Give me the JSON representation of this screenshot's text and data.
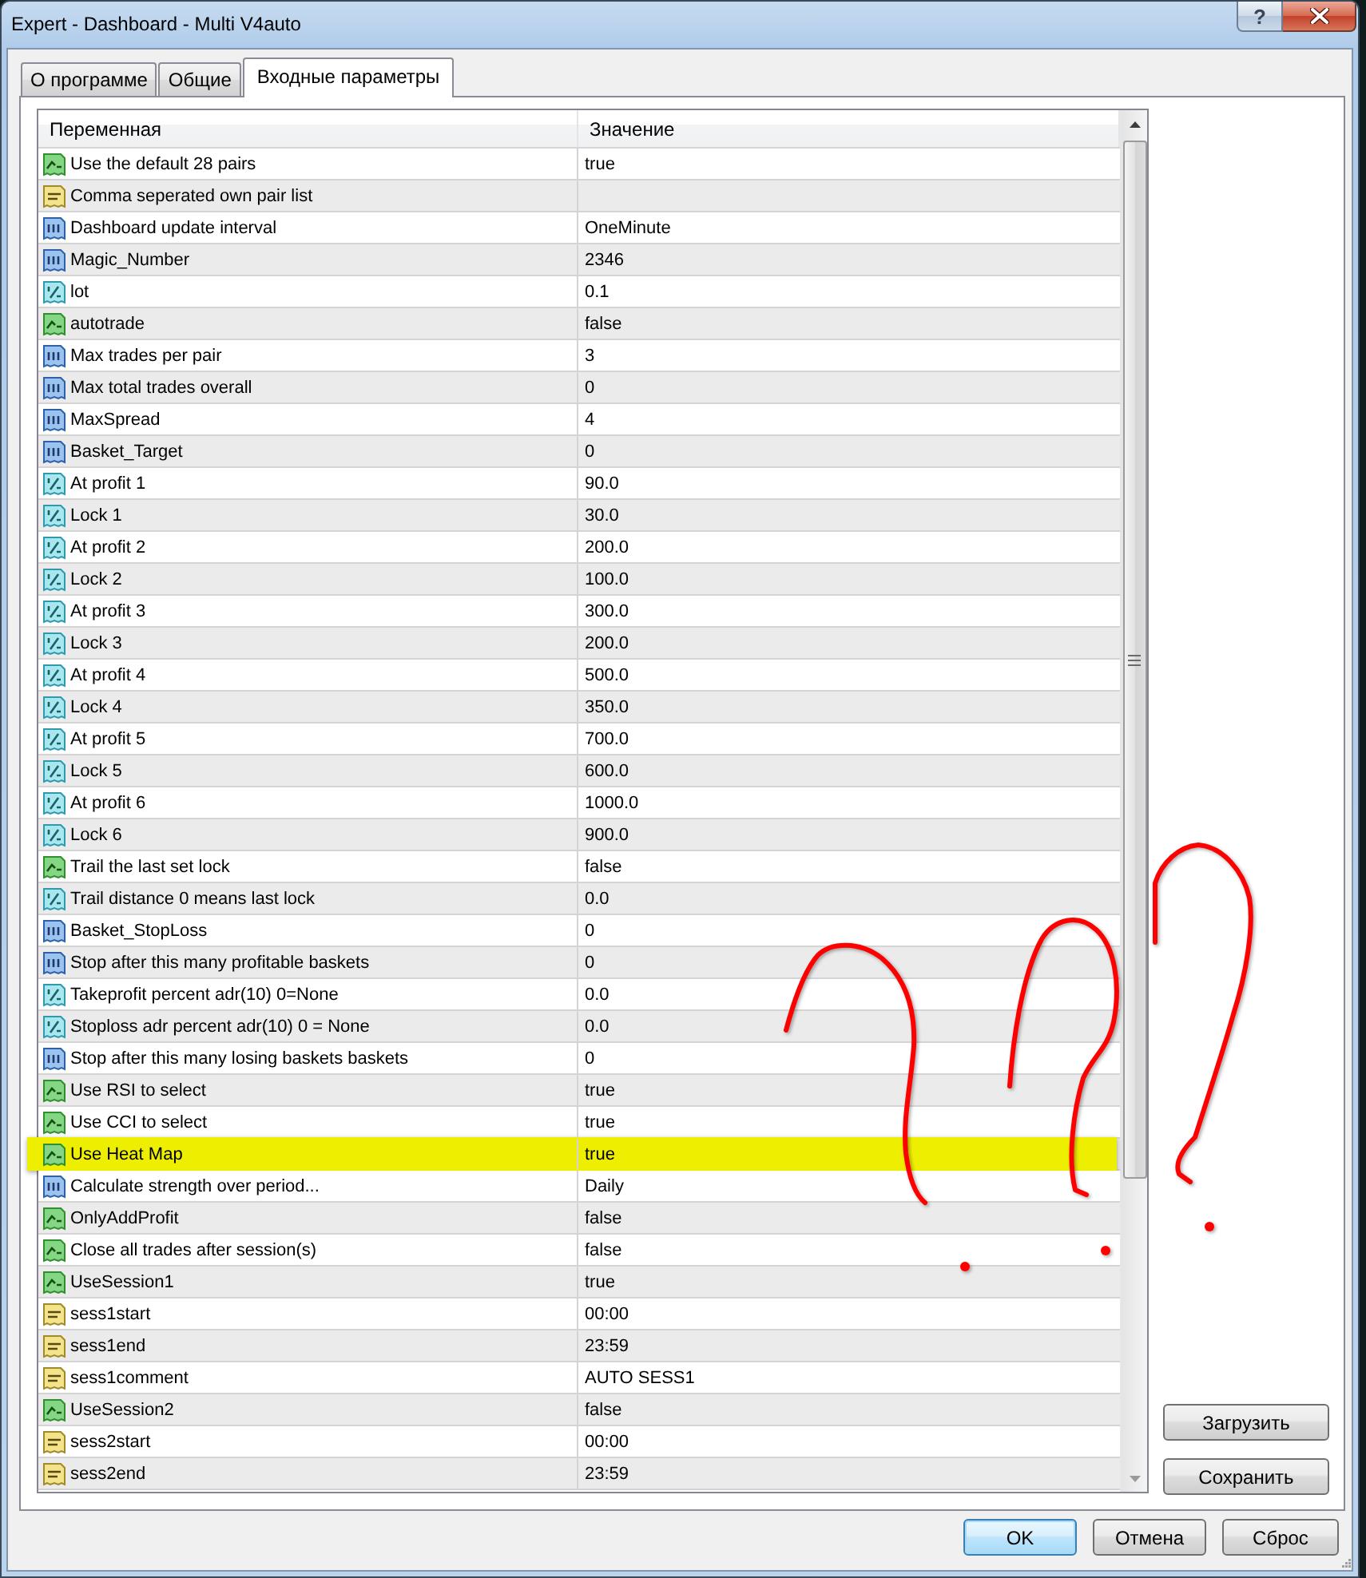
{
  "window": {
    "title": "Expert - Dashboard - Multi V4auto",
    "help_button": "?"
  },
  "tabs": [
    {
      "label": "О программе",
      "selected": false
    },
    {
      "label": "Общие",
      "selected": false
    },
    {
      "label": "Входные параметры",
      "selected": true
    }
  ],
  "table": {
    "columns": [
      "Переменная",
      "Значение"
    ],
    "rows": [
      {
        "kind": "bool",
        "name": "Use the default 28 pairs",
        "value": "true",
        "highlighted": false
      },
      {
        "kind": "string",
        "name": "Comma seperated own pair list",
        "highlighted": false
      },
      {
        "kind": "int",
        "name": "Dashboard update interval",
        "value": "OneMinute",
        "highlighted": false
      },
      {
        "kind": "int",
        "name": "Magic_Number",
        "value": "2346",
        "highlighted": false
      },
      {
        "kind": "double",
        "name": "lot",
        "value": "0.1",
        "highlighted": false
      },
      {
        "kind": "bool",
        "name": "autotrade",
        "value": "false",
        "highlighted": false
      },
      {
        "kind": "int",
        "name": "Max trades per pair",
        "value": "3",
        "highlighted": false
      },
      {
        "kind": "int",
        "name": "Max total trades overall",
        "value": "0",
        "highlighted": false
      },
      {
        "kind": "int",
        "name": "MaxSpread",
        "value": "4",
        "highlighted": false
      },
      {
        "kind": "int",
        "name": "Basket_Target",
        "value": "0",
        "highlighted": false
      },
      {
        "kind": "double",
        "name": "At profit 1",
        "value": "90.0",
        "highlighted": false
      },
      {
        "kind": "double",
        "name": "Lock 1",
        "value": "30.0",
        "highlighted": false
      },
      {
        "kind": "double",
        "name": "At profit 2",
        "value": "200.0",
        "highlighted": false
      },
      {
        "kind": "double",
        "name": "Lock 2",
        "value": "100.0",
        "highlighted": false
      },
      {
        "kind": "double",
        "name": "At profit 3",
        "value": "300.0",
        "highlighted": false
      },
      {
        "kind": "double",
        "name": "Lock 3",
        "value": "200.0",
        "highlighted": false
      },
      {
        "kind": "double",
        "name": "At profit 4",
        "value": "500.0",
        "highlighted": false
      },
      {
        "kind": "double",
        "name": "Lock 4",
        "value": "350.0",
        "highlighted": false
      },
      {
        "kind": "double",
        "name": "At profit 5",
        "value": "700.0",
        "highlighted": false
      },
      {
        "kind": "double",
        "name": "Lock 5",
        "value": "600.0",
        "highlighted": false
      },
      {
        "kind": "double",
        "name": "At profit 6",
        "value": "1000.0",
        "highlighted": false
      },
      {
        "kind": "double",
        "name": "Lock 6",
        "value": "900.0",
        "highlighted": false
      },
      {
        "kind": "bool",
        "name": "Trail the last set lock",
        "value": "false",
        "highlighted": false
      },
      {
        "kind": "double",
        "name": "Trail distance 0 means last lock",
        "value": "0.0",
        "highlighted": false
      },
      {
        "kind": "int",
        "name": "Basket_StopLoss",
        "value": "0",
        "highlighted": false
      },
      {
        "kind": "int",
        "name": "Stop after this many profitable baskets",
        "value": "0",
        "highlighted": false
      },
      {
        "kind": "double",
        "name": "Takeprofit percent adr(10) 0=None",
        "value": "0.0",
        "highlighted": false
      },
      {
        "kind": "double",
        "name": "Stoploss adr percent adr(10) 0 = None",
        "value": "0.0",
        "highlighted": false
      },
      {
        "kind": "int",
        "name": "Stop after this many losing baskets baskets",
        "value": "0",
        "highlighted": false
      },
      {
        "kind": "bool",
        "name": "Use RSI to select",
        "value": "true",
        "highlighted": false
      },
      {
        "kind": "bool",
        "name": "Use CCI to select",
        "value": "true",
        "highlighted": false
      },
      {
        "kind": "bool",
        "name": "Use Heat Map",
        "value": "true",
        "highlighted": true
      },
      {
        "kind": "int",
        "name": "Calculate strength over period...",
        "value": "Daily",
        "highlighted": false
      },
      {
        "kind": "bool",
        "name": "OnlyAddProfit",
        "value": "false",
        "highlighted": false
      },
      {
        "kind": "bool",
        "name": "Close all trades after session(s)",
        "value": "false",
        "highlighted": false
      },
      {
        "kind": "bool",
        "name": "UseSession1",
        "value": "true",
        "highlighted": false
      },
      {
        "kind": "string",
        "name": "sess1start",
        "value": "00:00",
        "highlighted": false
      },
      {
        "kind": "string",
        "name": "sess1end",
        "value": "23:59",
        "highlighted": false
      },
      {
        "kind": "string",
        "name": "sess1comment",
        "value": "AUTO SESS1",
        "highlighted": false
      },
      {
        "kind": "bool",
        "name": "UseSession2",
        "value": "false",
        "highlighted": false
      },
      {
        "kind": "string",
        "name": "sess2start",
        "value": "00:00",
        "highlighted": false
      },
      {
        "kind": "string",
        "name": "sess2end",
        "value": "23:59",
        "highlighted": false
      }
    ]
  },
  "side_buttons": [
    "Загрузить",
    "Сохранить"
  ],
  "buttons": [
    {
      "label": "OK",
      "default": true
    },
    {
      "label": "Отмена",
      "default": false
    },
    {
      "label": "Сброс",
      "default": false
    }
  ]
}
